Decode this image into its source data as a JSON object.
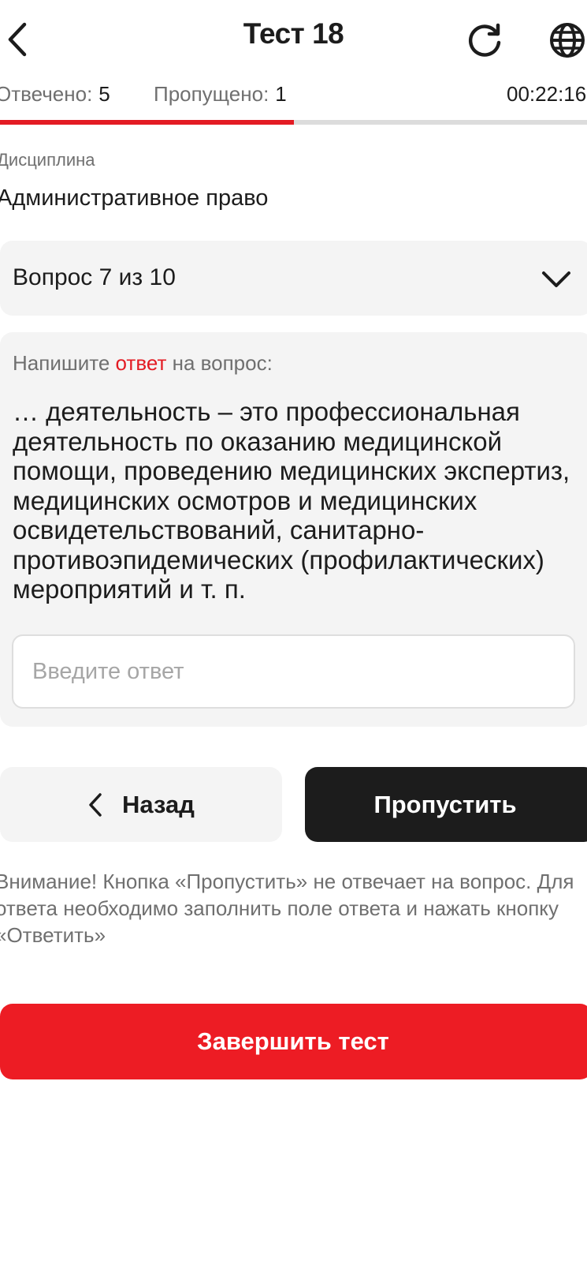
{
  "header": {
    "title": "Тест 18",
    "back_icon": "chevron-left-icon",
    "refresh_icon": "refresh-icon",
    "language_icon": "globe-icon"
  },
  "stats": {
    "answered_label": "Отвечено:",
    "answered_value": "5",
    "skipped_label": "Пропущено:",
    "skipped_value": "1",
    "timer": "00:22:16",
    "progress_fraction": 0.5
  },
  "discipline": {
    "label": "Дисциплина",
    "value": "Административное право"
  },
  "question_selector": {
    "label": "Вопрос 7 из 10",
    "icon": "chevron-down-icon"
  },
  "question": {
    "prompt_prefix": "Напишите ",
    "prompt_accent": "ответ",
    "prompt_suffix": " на вопрос:",
    "text": "… деятельность – это профессиональная деятельность по оказанию медицинской помощи, проведению медицинских экспертиз, медицинских осмотров и медицинских освидетельствований, санитарно-противоэпидемических (профилактических) мероприятий и т. п.",
    "answer_placeholder": "Введите ответ",
    "answer_value": ""
  },
  "buttons": {
    "back_label": "Назад",
    "skip_label": "Пропустить",
    "finish_label": "Завершить тест"
  },
  "warning": "Внимание! Кнопка «Пропустить» не отвечает на вопрос. Для ответа необходимо заполнить поле ответа и нажать кнопку «Ответить»",
  "colors": {
    "accent": "#e31b23",
    "finish": "#ed1c24",
    "dark_button": "#1c1c1c",
    "panel": "#f4f4f4"
  }
}
